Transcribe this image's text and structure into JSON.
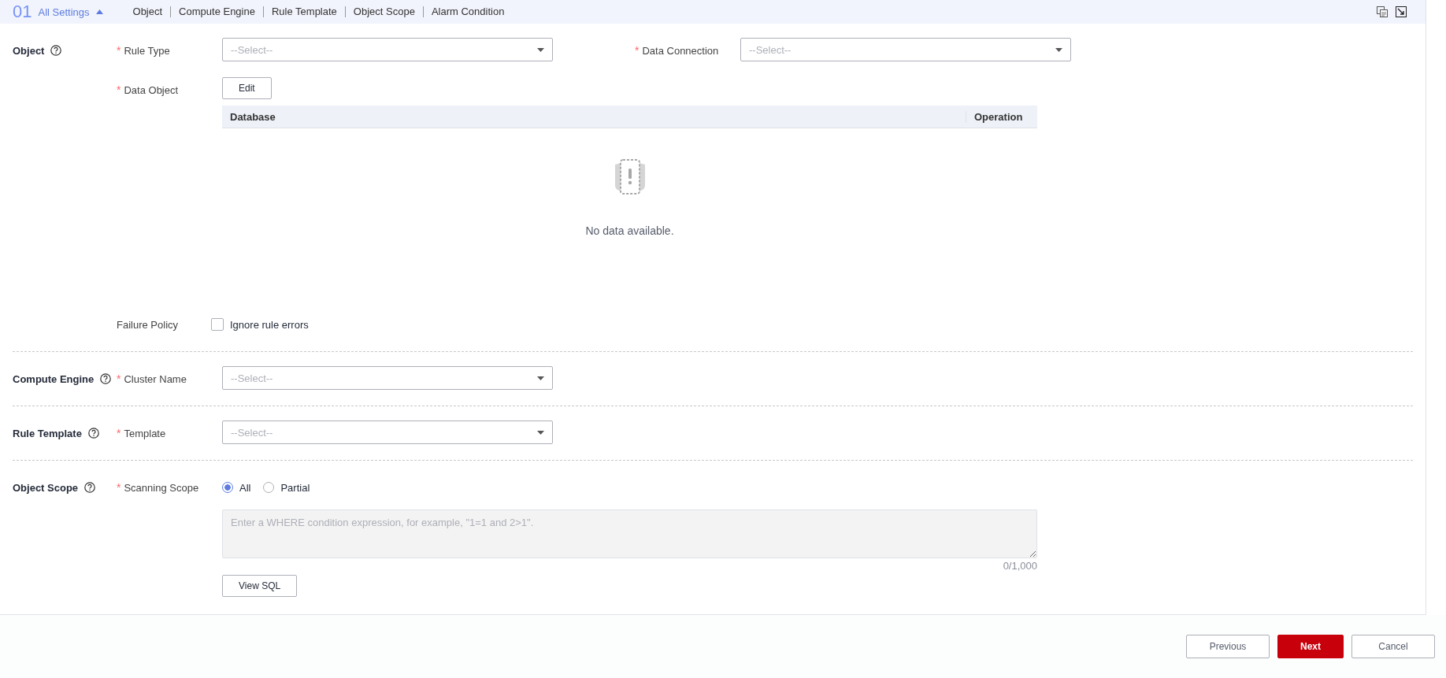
{
  "header": {
    "step": "01",
    "title": "All Settings",
    "expanded": true,
    "nav": [
      "Object",
      "Compute Engine",
      "Rule Template",
      "Object Scope",
      "Alarm Condition"
    ]
  },
  "sections": [
    {
      "title": "Object",
      "rows": [
        [
          {
            "kind": "select",
            "label": "Rule Type",
            "mark": "*",
            "placeholder": "--Select--"
          },
          {
            "kind": "select",
            "label": "Data Connection",
            "mark": "*",
            "placeholder": "--Select--"
          }
        ],
        [
          {
            "kind": "table",
            "label": "Data Object",
            "mark": "*",
            "button": "Edit",
            "columns": [
              "Database",
              "Operation"
            ],
            "empty_text": "No data available."
          }
        ],
        [
          {
            "kind": "checkbox",
            "label": "Failure Policy",
            "option": "Ignore rule errors",
            "checked": false
          }
        ]
      ]
    },
    {
      "title": "Compute Engine",
      "rows": [
        [
          {
            "kind": "select",
            "label": "Cluster Name",
            "mark": "*",
            "placeholder": "--Select--"
          }
        ]
      ]
    },
    {
      "title": "Rule Template",
      "rows": [
        [
          {
            "kind": "select",
            "label": "Template",
            "mark": "*",
            "placeholder": "--Select--"
          }
        ]
      ]
    },
    {
      "title": "Object Scope",
      "rows": [
        [
          {
            "kind": "radio",
            "label": "Scanning Scope",
            "mark": "*",
            "options": [
              {
                "label": "All",
                "selected": true
              },
              {
                "label": "Partial",
                "selected": false
              }
            ],
            "placeholder": "Enter a WHERE condition expression, for example, \"1=1 and 2>1\".",
            "counter": "0/1,000",
            "button": "View SQL"
          }
        ]
      ]
    }
  ],
  "footer": [
    {
      "label": "Previous",
      "kind": "default"
    },
    {
      "label": "Next",
      "kind": "primary"
    },
    {
      "label": "Cancel",
      "kind": "default"
    }
  ]
}
